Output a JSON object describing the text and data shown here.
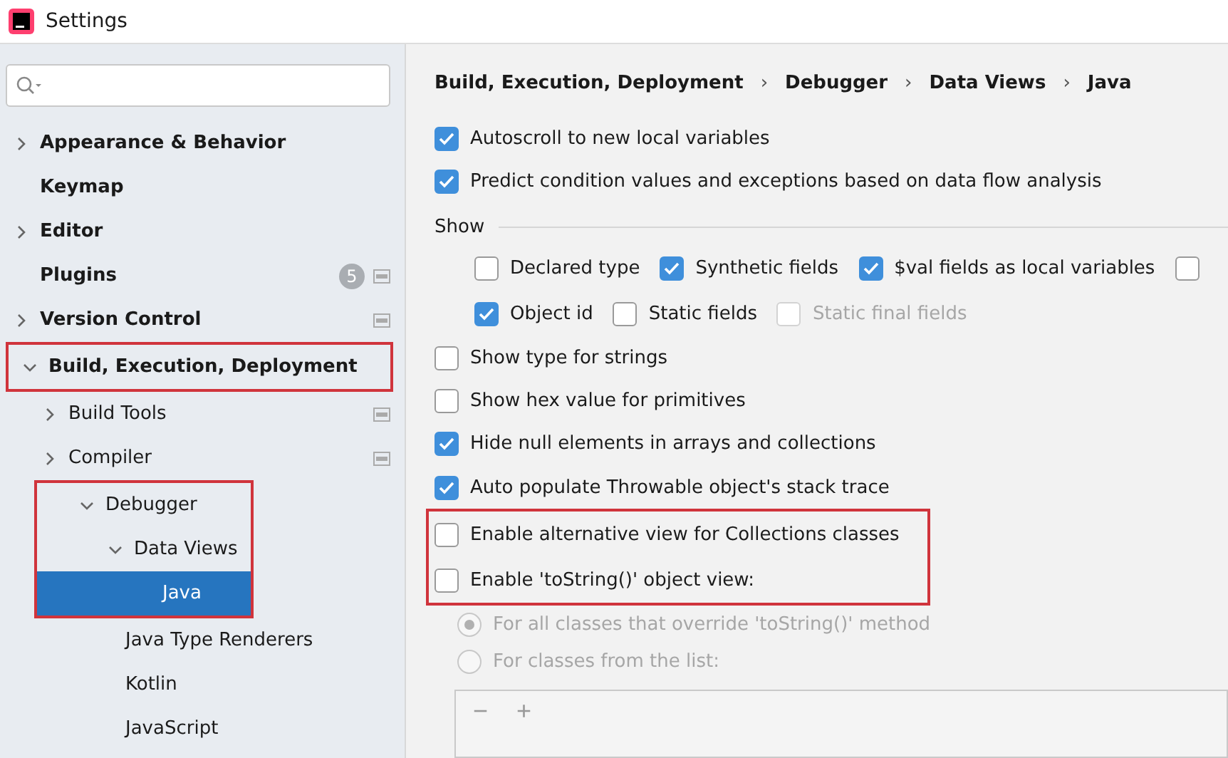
{
  "window": {
    "title": "Settings"
  },
  "tree": [
    {
      "label": "Appearance & Behavior",
      "bold": true,
      "expanded": false,
      "selected": false,
      "marked": false
    },
    {
      "label": "Keymap",
      "bold": true,
      "selected": false,
      "marked": false
    },
    {
      "label": "Editor",
      "bold": true,
      "expanded": false,
      "selected": false,
      "marked": false
    },
    {
      "label": "Plugins",
      "bold": true,
      "selected": false,
      "marked": false,
      "badge": "5",
      "scope_icon": true
    },
    {
      "label": "Version Control",
      "bold": true,
      "expanded": false,
      "selected": false,
      "marked": false,
      "scope_icon": true
    },
    {
      "label": "Build, Execution, Deployment",
      "bold": true,
      "expanded": true,
      "selected": false,
      "marked": true,
      "children": [
        {
          "label": "Build Tools",
          "bold": false,
          "expanded": false,
          "selected": false,
          "marked": false,
          "scope_icon": true
        },
        {
          "label": "Compiler",
          "bold": false,
          "expanded": false,
          "selected": false,
          "marked": false,
          "scope_icon": true
        },
        {
          "label": "Debugger",
          "bold": false,
          "expanded": true,
          "selected": false,
          "marked": true,
          "children": [
            {
              "label": "Data Views",
              "bold": false,
              "expanded": true,
              "selected": false,
              "marked": true,
              "children": [
                {
                  "label": "Java",
                  "bold": false,
                  "selected": true,
                  "marked": true
                },
                {
                  "label": "Java Type Renderers",
                  "bold": false,
                  "selected": false,
                  "marked": false
                },
                {
                  "label": "Kotlin",
                  "bold": false,
                  "selected": false,
                  "marked": false
                },
                {
                  "label": "JavaScript",
                  "bold": false,
                  "selected": false,
                  "marked": false
                }
              ]
            }
          ]
        }
      ]
    }
  ],
  "breadcrumbs": [
    {
      "label": "Build, Execution, Deployment"
    },
    {
      "separator": "›",
      "label": "Debugger"
    },
    {
      "separator": "›",
      "label": "Data Views"
    },
    {
      "separator": "›",
      "label": "Java"
    }
  ],
  "options": [
    {
      "kind": "checkbox",
      "label": "Autoscroll to new local variables",
      "checked": true,
      "disabled": false,
      "marked": false
    },
    {
      "kind": "checkbox",
      "label": "Predict condition values and exceptions based on data flow analysis",
      "checked": true,
      "disabled": false,
      "marked": false
    },
    {
      "kind": "group",
      "title": "Show",
      "rows": [
        [
          {
            "label": "Declared type",
            "checked": false,
            "disabled": false
          },
          {
            "label": "Synthetic fields",
            "checked": true,
            "disabled": false
          },
          {
            "label": "$val fields as local variables",
            "checked": true,
            "disabled": false
          },
          {
            "checked": false,
            "disabled": false
          }
        ],
        [
          {
            "label": "Object id",
            "checked": true,
            "disabled": false
          },
          {
            "label": "Static fields",
            "checked": false,
            "disabled": false
          },
          {
            "label": "Static final fields",
            "checked": false,
            "disabled": true
          }
        ]
      ]
    },
    {
      "kind": "checkbox",
      "label": "Show type for strings",
      "checked": false,
      "disabled": false,
      "marked": false
    },
    {
      "kind": "checkbox",
      "label": "Show hex value for primitives",
      "checked": false,
      "disabled": false,
      "marked": false
    },
    {
      "kind": "checkbox",
      "label": "Hide null elements in arrays and collections",
      "checked": true,
      "disabled": false,
      "marked": false
    },
    {
      "kind": "checkbox",
      "label": "Auto populate Throwable object's stack trace",
      "checked": true,
      "disabled": false,
      "marked": false
    },
    {
      "kind": "checkbox",
      "label": "Enable alternative view for Collections classes",
      "checked": false,
      "disabled": false,
      "marked": true
    },
    {
      "kind": "checkbox",
      "label": "Enable 'toString()' object view:",
      "checked": false,
      "disabled": false,
      "marked": true
    },
    {
      "kind": "radio",
      "label": "For all classes that override 'toString()' method",
      "selected": true,
      "disabled": true,
      "marked": false
    },
    {
      "kind": "radio",
      "label": "For classes from the list:",
      "selected": false,
      "disabled": true,
      "marked": false
    },
    {
      "kind": "listbox",
      "tools": [
        "−",
        "+"
      ]
    }
  ]
}
